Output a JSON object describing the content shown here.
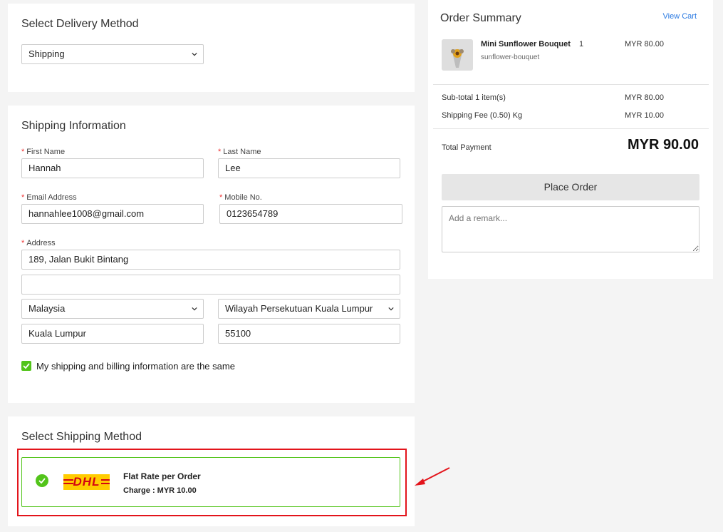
{
  "delivery": {
    "title": "Select Delivery Method",
    "selected": "Shipping"
  },
  "shipping_info": {
    "title": "Shipping Information",
    "first_name_label": "First Name",
    "first_name": "Hannah",
    "last_name_label": "Last Name",
    "last_name": "Lee",
    "email_label": "Email Address",
    "email": "hannahlee1008@gmail.com",
    "mobile_label": "Mobile No.",
    "mobile": "0123654789",
    "address_label": "Address",
    "address_line1": "189, Jalan Bukit Bintang",
    "address_line2": "",
    "country": "Malaysia",
    "state": "Wilayah Persekutuan Kuala Lumpur",
    "city": "Kuala Lumpur",
    "postcode": "55100",
    "same_billing_label": "My shipping and billing information are the same",
    "same_billing_checked": true
  },
  "shipping_method": {
    "title": "Select Shipping Method",
    "option_title": "Flat Rate per Order",
    "option_charge": "Charge : MYR 10.00",
    "carrier_logo_text": "DHL"
  },
  "summary": {
    "title": "Order Summary",
    "view_cart": "View Cart",
    "item_name": "Mini Sunflower Bouquet",
    "item_slug": "sunflower-bouquet",
    "item_qty": "1",
    "item_price": "MYR 80.00",
    "subtotal_label": "Sub-total 1 item(s)",
    "subtotal_value": "MYR 80.00",
    "shipping_fee_label": "Shipping Fee (0.50) Kg",
    "shipping_fee_value": "MYR 10.00",
    "total_label": "Total Payment",
    "total_value": "MYR 90.00",
    "place_order": "Place Order",
    "remark_placeholder": "Add a remark..."
  },
  "colors": {
    "accent_blue": "#2a7ae2",
    "check_green": "#52c41a",
    "highlight_red": "#e3141b",
    "dhl_yellow": "#ffcc00",
    "dhl_red": "#d40511"
  }
}
